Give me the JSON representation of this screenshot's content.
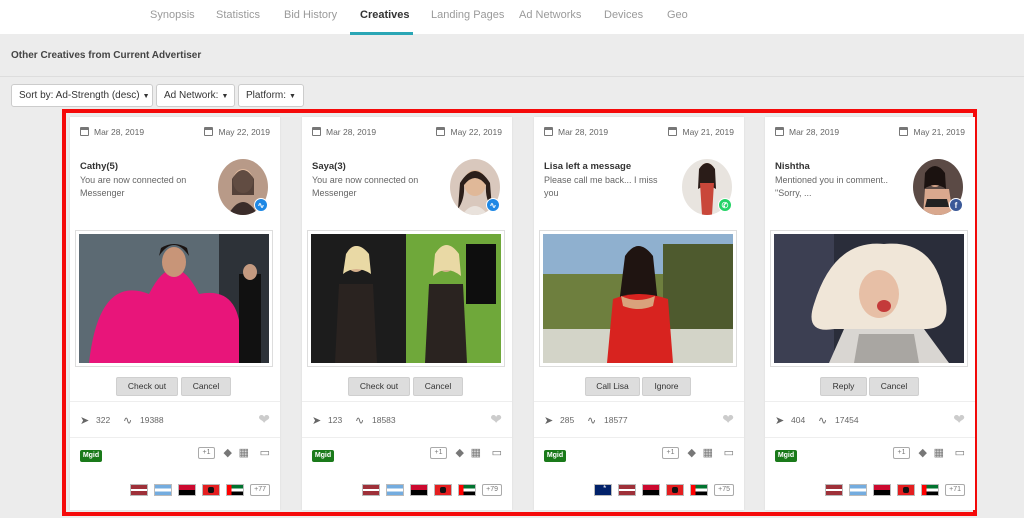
{
  "nav": {
    "tabs": [
      "Synopsis",
      "Statistics",
      "Bid History",
      "Creatives",
      "Landing Pages",
      "Ad Networks",
      "Devices",
      "Geo"
    ],
    "active": "Creatives"
  },
  "section_title": "Other Creatives from Current Advertiser",
  "filters": {
    "sort": "Sort by: Ad-Strength (desc)",
    "network": "Ad Network:",
    "platform": "Platform:"
  },
  "cards": [
    {
      "first_seen": "Mar 28, 2019",
      "last_seen": "May 22, 2019",
      "title": "Cathy(5)",
      "text": "You are now connected on Messenger",
      "avatar_badge_icon": "messenger-icon",
      "buttons": [
        "Check out",
        "Cancel"
      ],
      "stat1": "322",
      "stat2": "19388",
      "network": "Mgid",
      "plus": "+1",
      "flags": [
        "lv",
        "ar",
        "ao",
        "al",
        "ae"
      ],
      "more_flags": "+77"
    },
    {
      "first_seen": "Mar 28, 2019",
      "last_seen": "May 22, 2019",
      "title": "Saya(3)",
      "text": "You are now connected on Messenger",
      "avatar_badge_icon": "messenger-icon",
      "buttons": [
        "Check out",
        "Cancel"
      ],
      "stat1": "123",
      "stat2": "18583",
      "network": "Mgid",
      "plus": "+1",
      "flags": [
        "lv",
        "ar",
        "ao",
        "al",
        "ae"
      ],
      "more_flags": "+79"
    },
    {
      "first_seen": "Mar 28, 2019",
      "last_seen": "May 21, 2019",
      "title": "Lisa left a message",
      "text": "Please call me back... I miss you",
      "avatar_badge_icon": "whatsapp-icon",
      "buttons": [
        "Call Lisa",
        "Ignore"
      ],
      "stat1": "285",
      "stat2": "18577",
      "network": "Mgid",
      "plus": "+1",
      "flags": [
        "au",
        "lv",
        "ao",
        "al",
        "ae"
      ],
      "more_flags": "+75"
    },
    {
      "first_seen": "Mar 28, 2019",
      "last_seen": "May 21, 2019",
      "title": "Nishtha",
      "text": "Mentioned you in comment.. \"Sorry, ...",
      "avatar_badge_icon": "facebook-icon",
      "buttons": [
        "Reply",
        "Cancel"
      ],
      "stat1": "404",
      "stat2": "17454",
      "network": "Mgid",
      "plus": "+1",
      "flags": [
        "lv",
        "ar",
        "ao",
        "al",
        "ae"
      ],
      "more_flags": "+71"
    }
  ],
  "colors": {
    "highlight_outline": "#f50a0a",
    "active_tab_underline": "#2aa6b5",
    "network_badge": "#1a7a1a"
  }
}
